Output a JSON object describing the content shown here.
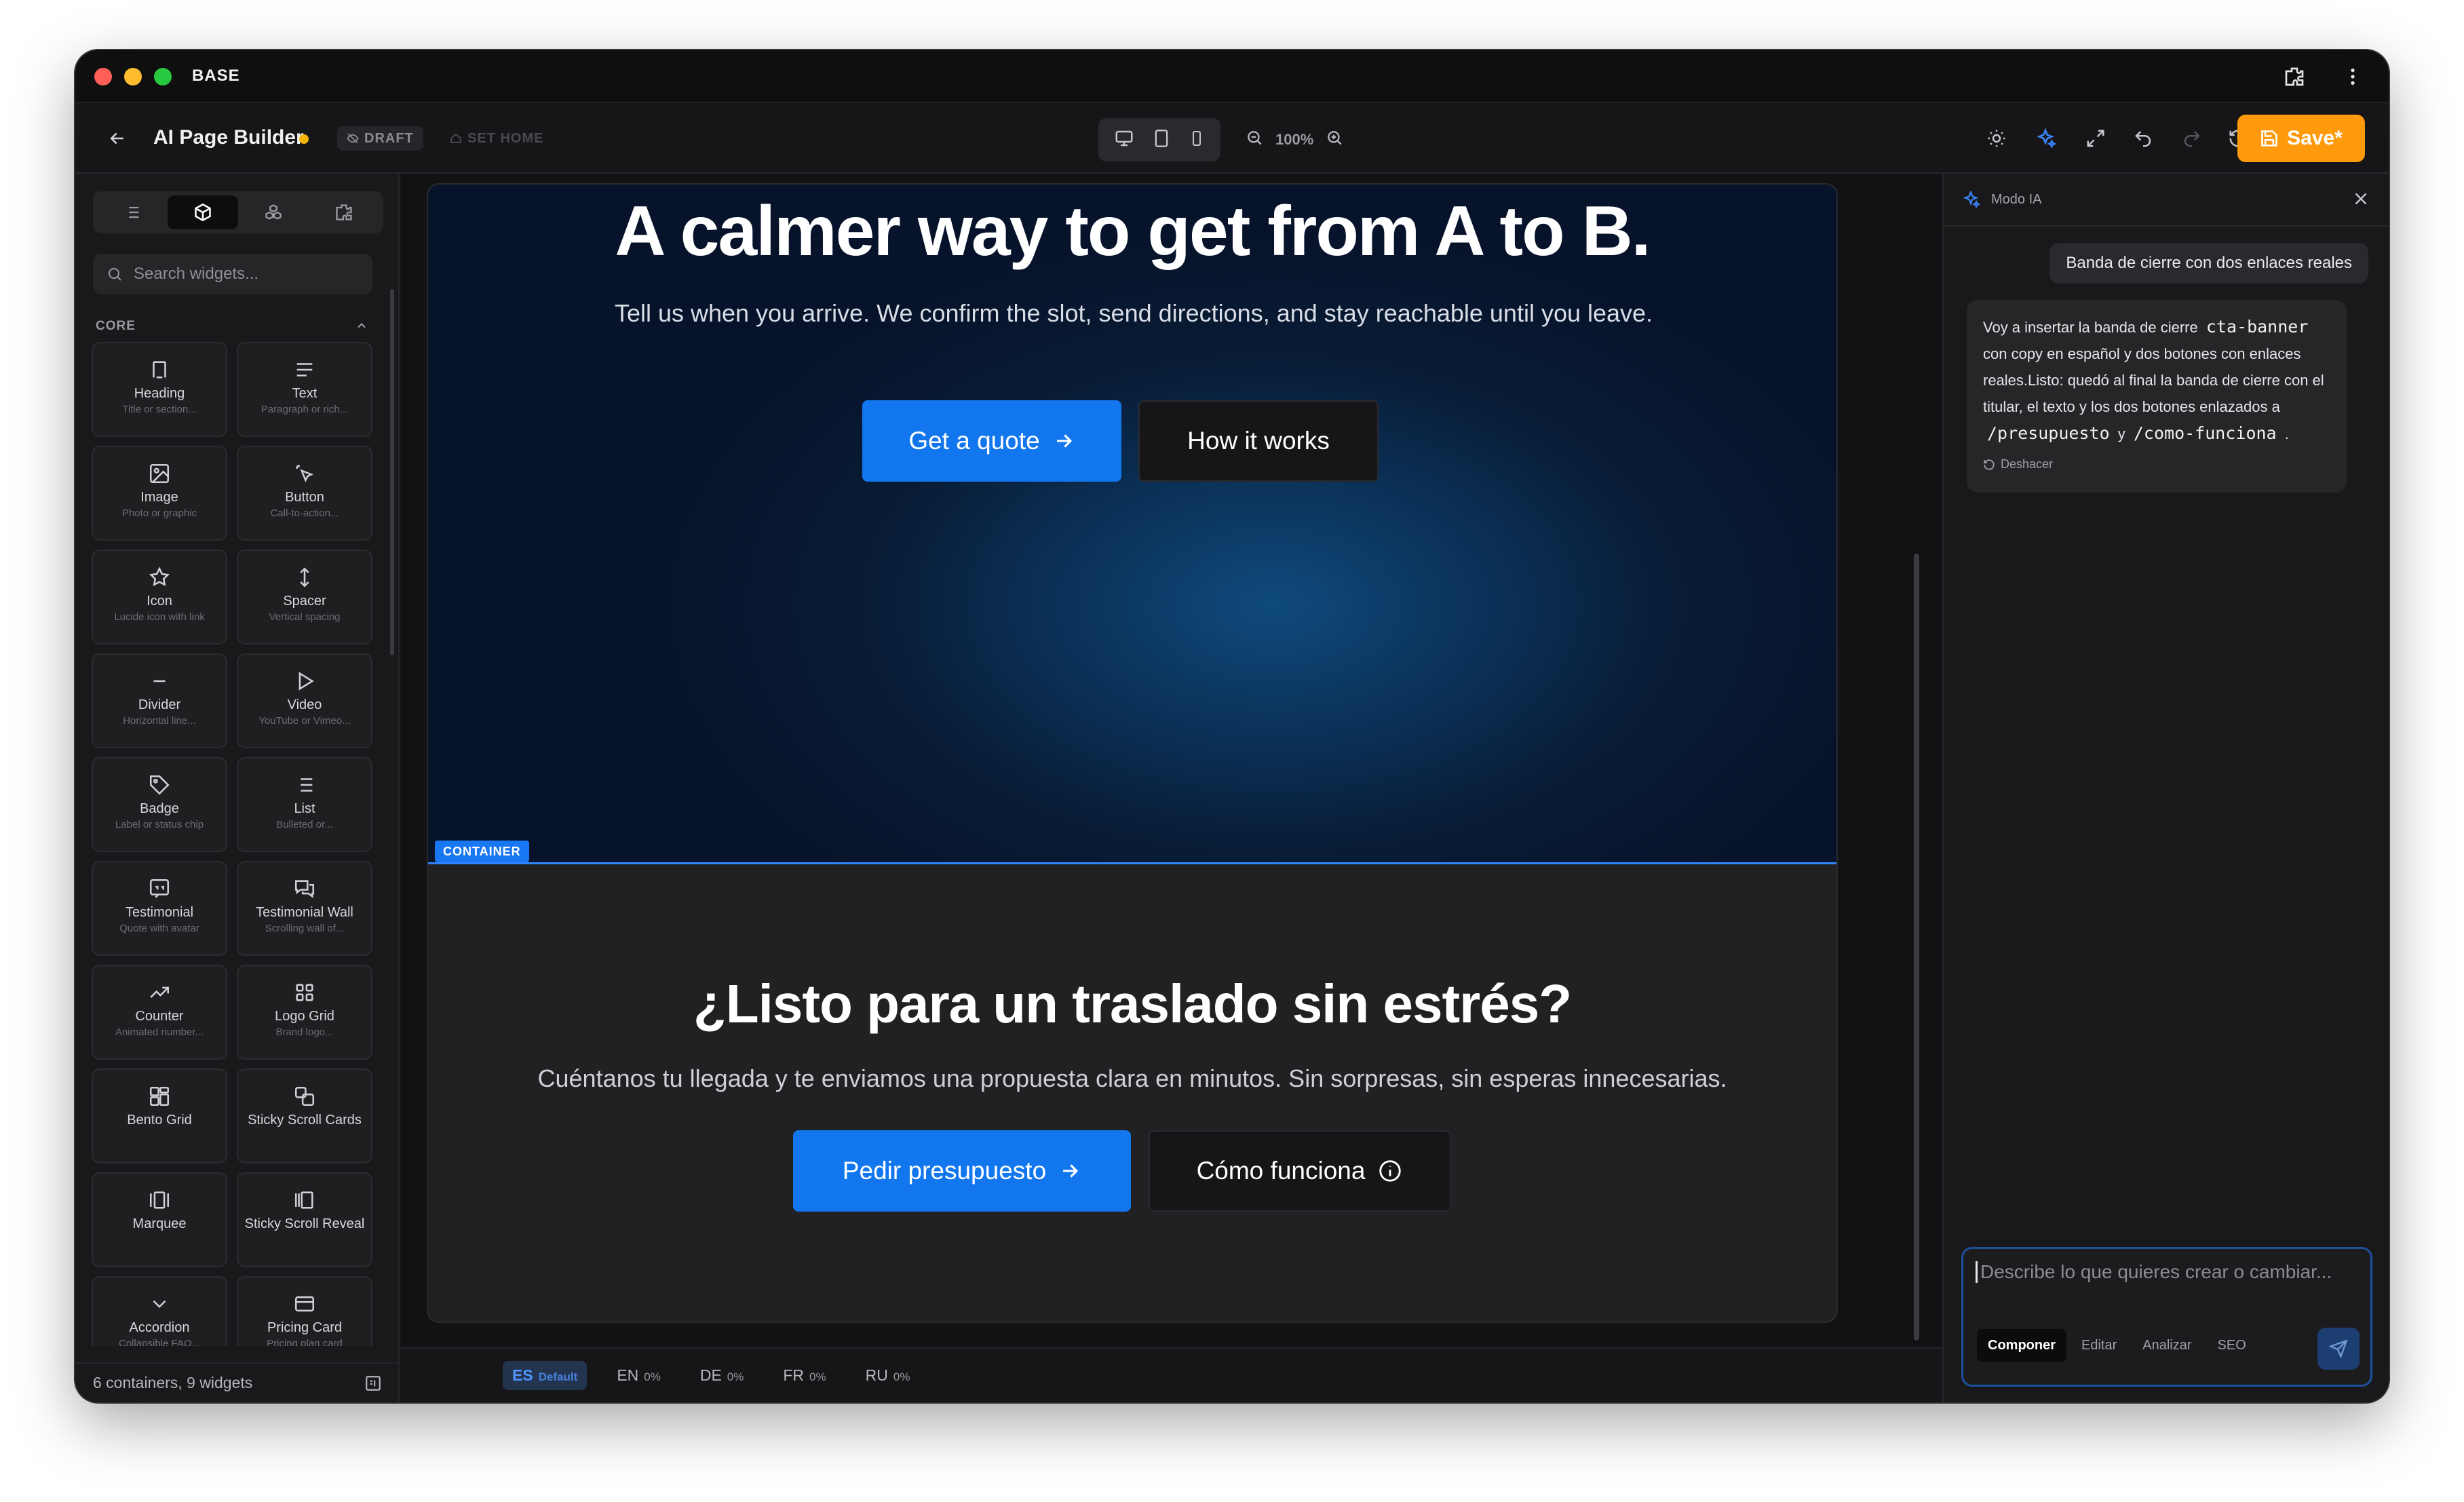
{
  "window": {
    "title": "BASE"
  },
  "toolbar": {
    "app_title": "AI Page Builder",
    "draft_label": "DRAFT",
    "set_home_label": "SET HOME",
    "zoom_level": "100%",
    "save_label": "Save*"
  },
  "sidebar": {
    "search_placeholder": "Search widgets...",
    "section_title": "CORE",
    "widgets": [
      {
        "name": "Heading",
        "sub": "Title or section...",
        "icon": "heading-icon"
      },
      {
        "name": "Text",
        "sub": "Paragraph or rich...",
        "icon": "text-icon"
      },
      {
        "name": "Image",
        "sub": "Photo or graphic",
        "icon": "image-icon"
      },
      {
        "name": "Button",
        "sub": "Call-to-action...",
        "icon": "pointer-icon"
      },
      {
        "name": "Icon",
        "sub": "Lucide icon with link",
        "icon": "star-icon"
      },
      {
        "name": "Spacer",
        "sub": "Vertical spacing",
        "icon": "vertical-arrows-icon"
      },
      {
        "name": "Divider",
        "sub": "Horizontal line...",
        "icon": "minus-icon"
      },
      {
        "name": "Video",
        "sub": "YouTube or Vimeo...",
        "icon": "play-icon"
      },
      {
        "name": "Badge",
        "sub": "Label or status chip",
        "icon": "tag-icon"
      },
      {
        "name": "List",
        "sub": "Bulleted or...",
        "icon": "list-icon"
      },
      {
        "name": "Testimonial",
        "sub": "Quote with avatar",
        "icon": "quote-icon"
      },
      {
        "name": "Testimonial Wall",
        "sub": "Scrolling wall of...",
        "icon": "messages-icon"
      },
      {
        "name": "Counter",
        "sub": "Animated number...",
        "icon": "trending-up-icon"
      },
      {
        "name": "Logo Grid",
        "sub": "Brand logo...",
        "icon": "grid-icon"
      },
      {
        "name": "Bento Grid",
        "sub": "",
        "icon": "bento-icon"
      },
      {
        "name": "Sticky Scroll Cards",
        "sub": "",
        "icon": "cards-icon"
      },
      {
        "name": "Marquee",
        "sub": "",
        "icon": "marquee-icon"
      },
      {
        "name": "Sticky Scroll Reveal",
        "sub": "",
        "icon": "reveal-icon"
      },
      {
        "name": "Accordion",
        "sub": "Collapsible FAQ...",
        "icon": "chevron-down-icon"
      },
      {
        "name": "Pricing Card",
        "sub": "Pricing plan card",
        "icon": "credit-card-icon"
      }
    ],
    "footer_status": "6 containers, 9 widgets"
  },
  "canvas": {
    "hero": {
      "title": "A calmer way to get from A to B.",
      "subtitle": "Tell us when you arrive. We confirm the slot, send directions, and stay reachable until you leave.",
      "primary_button": "Get a quote",
      "secondary_button": "How it works"
    },
    "container_label": "CONTAINER",
    "cta": {
      "title": "¿Listo para un traslado sin estrés?",
      "subtitle": "Cuéntanos tu llegada y te enviamos una propuesta clara en minutos. Sin sorpresas, sin esperas innecesarias.",
      "primary_button": "Pedir presupuesto",
      "secondary_button": "Cómo funciona"
    }
  },
  "languages": [
    {
      "code": "ES",
      "note": "Default"
    },
    {
      "code": "EN",
      "note": "0%"
    },
    {
      "code": "DE",
      "note": "0%"
    },
    {
      "code": "FR",
      "note": "0%"
    },
    {
      "code": "RU",
      "note": "0%"
    }
  ],
  "ai_panel": {
    "title": "Modo IA",
    "user_message": "Banda de cierre con dos enlaces reales",
    "assistant_message": {
      "part1": "Voy a insertar la banda de cierre",
      "code1": "cta-banner",
      "part2": "con copy en español y dos botones con enlaces reales.Listo: quedó al final la banda de cierre con el titular, el texto y los dos botones enlazados a",
      "code2": "/presupuesto",
      "part3": "y",
      "code3": "/como-funciona",
      "part4": "."
    },
    "undo_label": "Deshacer",
    "composer_placeholder": "Describe lo que quieres crear o cambiar...",
    "modes": [
      "Componer",
      "Editar",
      "Analizar",
      "SEO"
    ]
  },
  "colors": {
    "accent": "#1277ee",
    "save": "#ff9a0c",
    "draft_dot": "#f5b60a"
  }
}
